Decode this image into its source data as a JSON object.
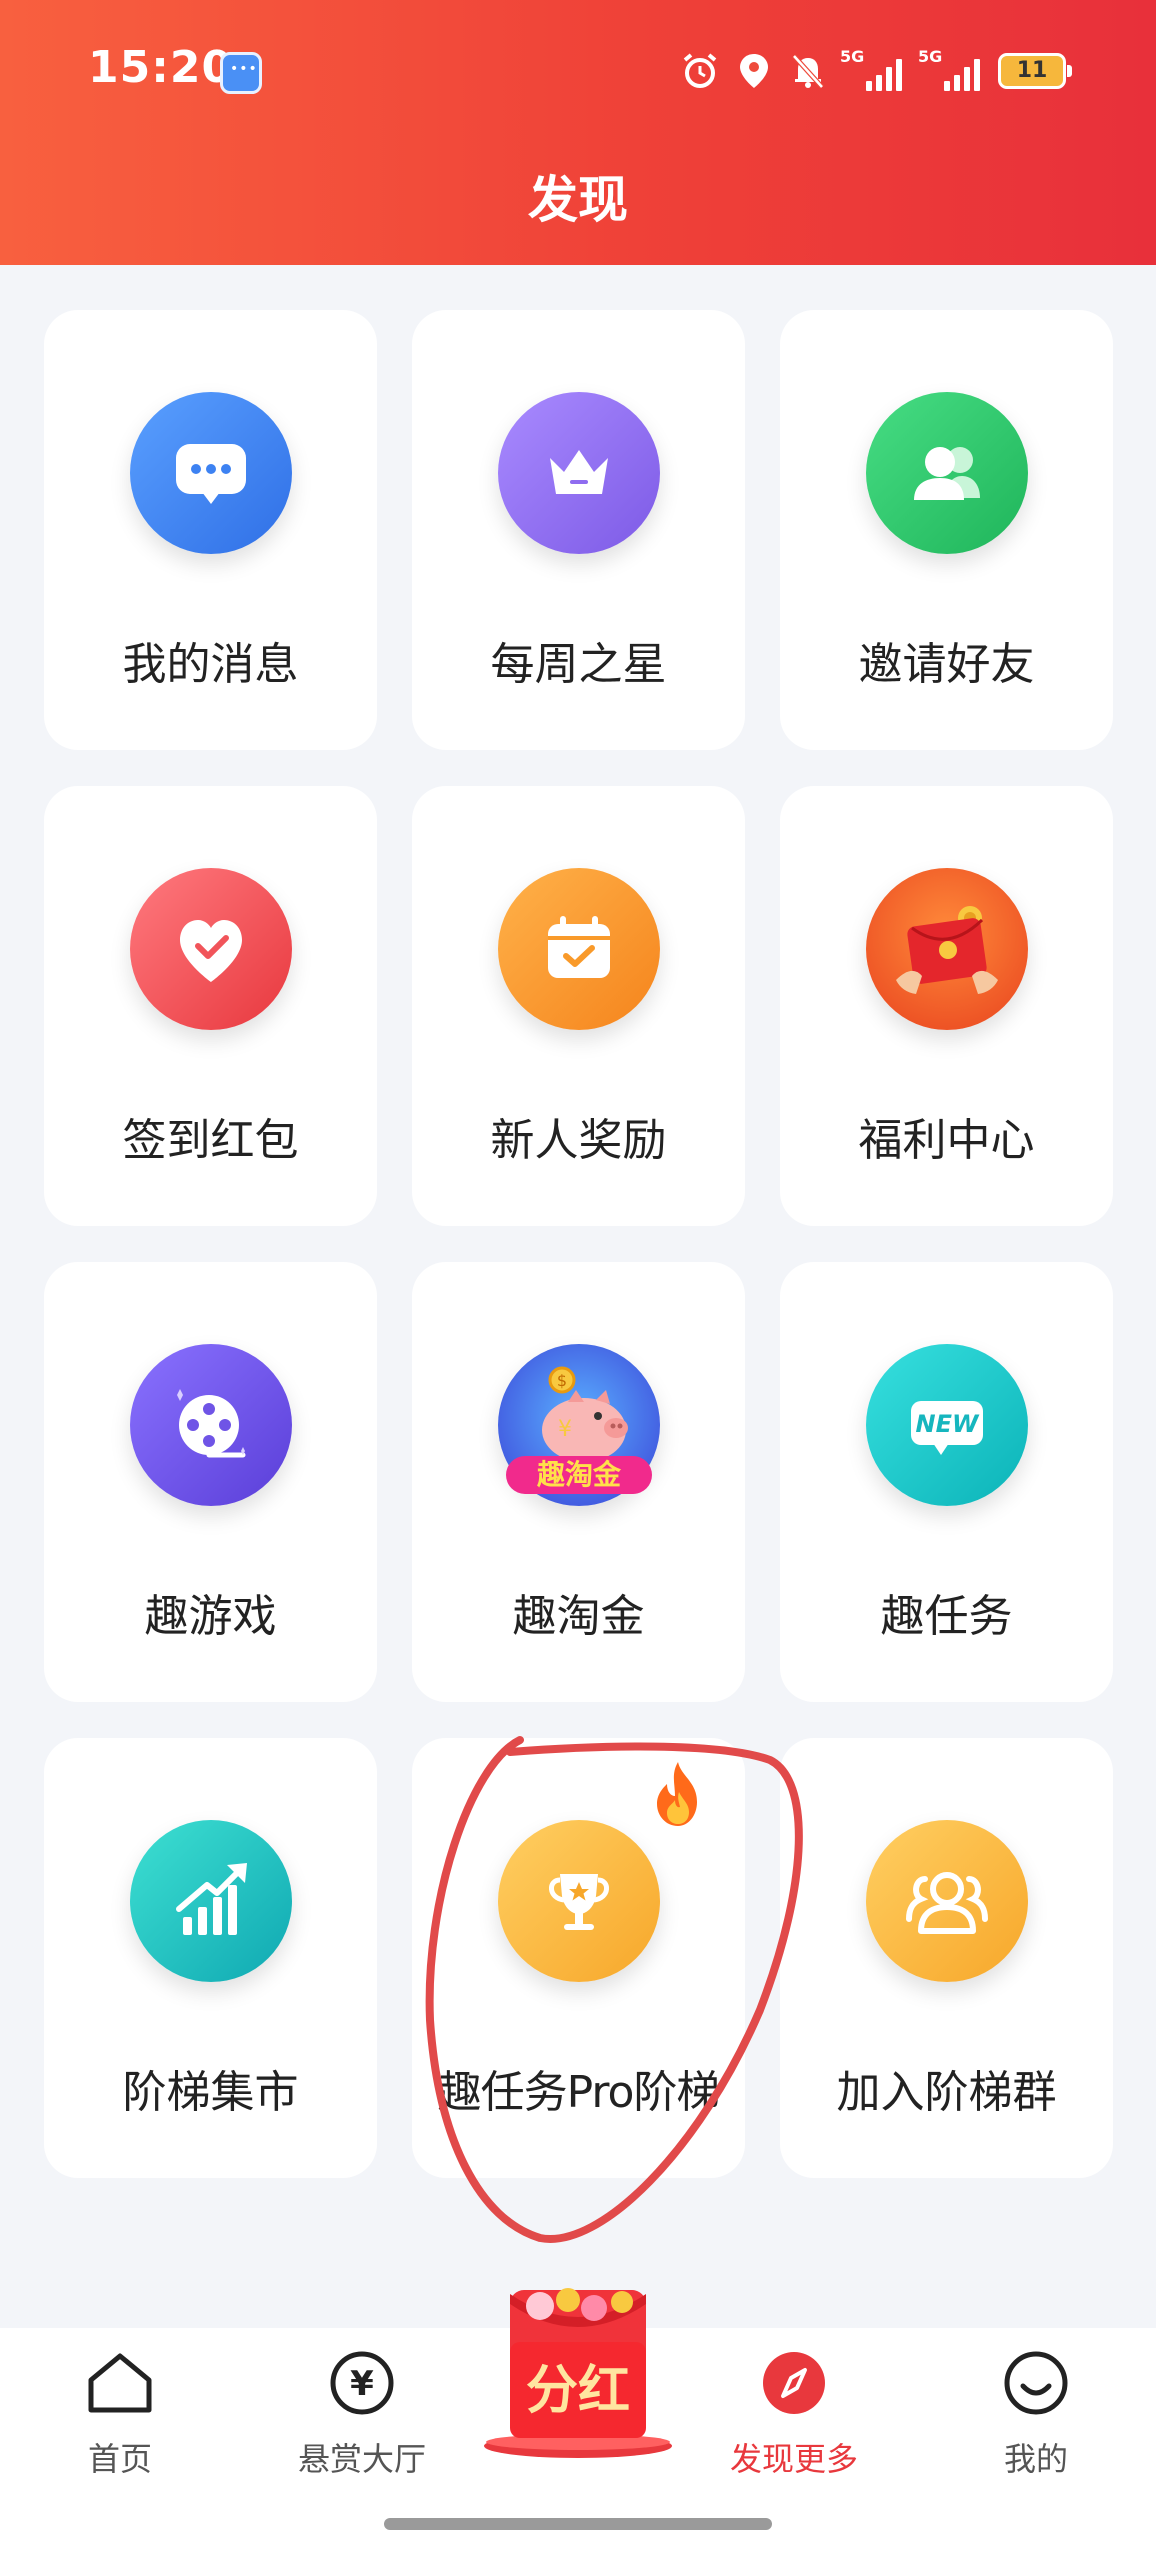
{
  "status_bar": {
    "time": "15:20",
    "signal1_tag": "5G",
    "signal2_tag": "5G",
    "battery_level": "11"
  },
  "header": {
    "title": "发现"
  },
  "grid": {
    "items": [
      {
        "label": "我的消息",
        "icon": "message-icon",
        "color": "#3d82f2"
      },
      {
        "label": "每周之星",
        "icon": "crown-icon",
        "color": "#8f6cf0"
      },
      {
        "label": "邀请好友",
        "icon": "friends-icon",
        "color": "#2bc96b"
      },
      {
        "label": "签到红包",
        "icon": "checkin-heart-icon",
        "color": "#f1545a"
      },
      {
        "label": "新人奖励",
        "icon": "calendar-check-icon",
        "color": "#f99a2a"
      },
      {
        "label": "福利中心",
        "icon": "red-envelope-icon",
        "color": "#ef5a2f"
      },
      {
        "label": "趣游戏",
        "icon": "film-reel-icon",
        "color": "#6f54e6"
      },
      {
        "label": "趣淘金",
        "icon": "piggy-bank-icon",
        "badge_text": "趣淘金",
        "color": "#3a3fd6"
      },
      {
        "label": "趣任务",
        "icon": "new-badge-icon",
        "badge_text": "NEW",
        "color": "#16c7c7"
      },
      {
        "label": "阶梯集市",
        "icon": "growth-chart-icon",
        "color": "#14c2bd"
      },
      {
        "label": "趣任务Pro阶梯",
        "icon": "trophy-icon",
        "color": "#fbb640",
        "hot": "fire-icon"
      },
      {
        "label": "加入阶梯群",
        "icon": "group-icon",
        "color": "#fbb640"
      }
    ]
  },
  "bottom_nav": {
    "items": [
      {
        "label": "首页",
        "icon": "home-icon"
      },
      {
        "label": "悬赏大厅",
        "icon": "yen-icon",
        "glyph": "¥"
      },
      {
        "label": "发现更多",
        "icon": "compass-icon",
        "active": true
      },
      {
        "label": "我的",
        "icon": "smile-icon"
      }
    ],
    "center_promo": {
      "label": "分红",
      "icon": "red-envelope-promo-icon"
    }
  },
  "colors": {
    "header_start": "#f8603f",
    "header_end": "#e8303a",
    "active_nav": "#e8383d",
    "annotation": "#e14a4a"
  }
}
